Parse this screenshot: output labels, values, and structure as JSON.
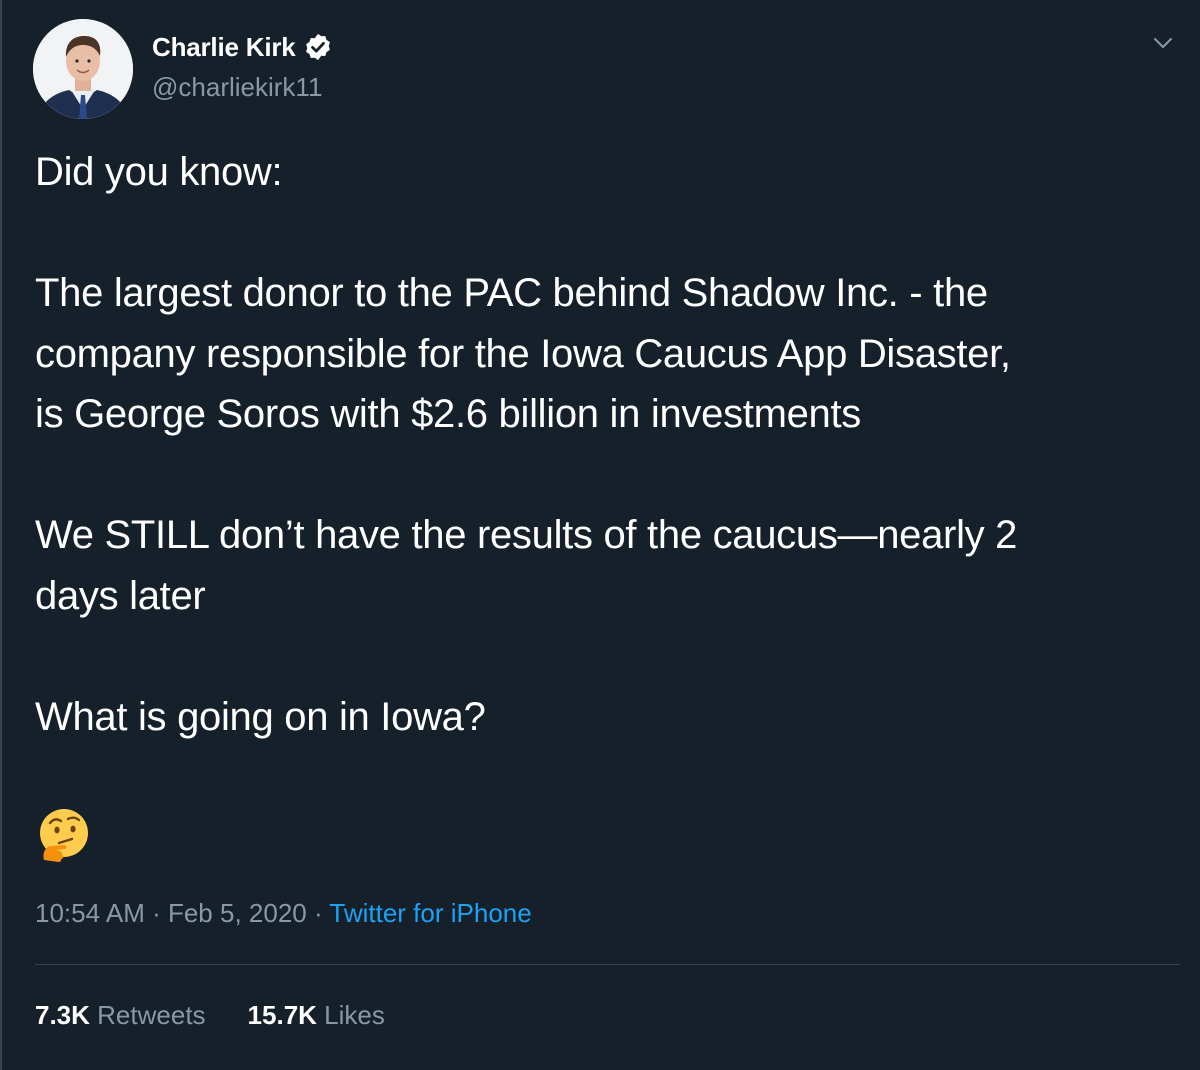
{
  "author": {
    "name": "Charlie Kirk",
    "handle": "@charliekirk11",
    "verified": true,
    "avatar_icon": "profile-photo"
  },
  "tweet": {
    "paragraphs": [
      "Did you know:",
      "The largest donor to the PAC behind Shadow Inc. - the\ncompany responsible for the Iowa Caucus App Disaster,\nis George Soros with $2.6 billion in investments",
      "We STILL don’t have the results of the caucus—nearly 2\ndays later",
      "What is going on in Iowa?"
    ],
    "emoji": "thinking-face"
  },
  "meta": {
    "time": "10:54 AM",
    "separator": " · ",
    "date": "Feb 5, 2020",
    "source": "Twitter for iPhone"
  },
  "stats": {
    "retweets_count": "7.3K",
    "retweets_label": "Retweets",
    "likes_count": "15.7K",
    "likes_label": "Likes"
  },
  "colors": {
    "background": "#15202b",
    "text_primary": "#ffffff",
    "text_secondary": "#8899a6",
    "accent": "#1da1f2",
    "divider": "#38444d"
  },
  "icons": {
    "verified": "verified-badge-icon",
    "menu": "chevron-down-icon"
  }
}
